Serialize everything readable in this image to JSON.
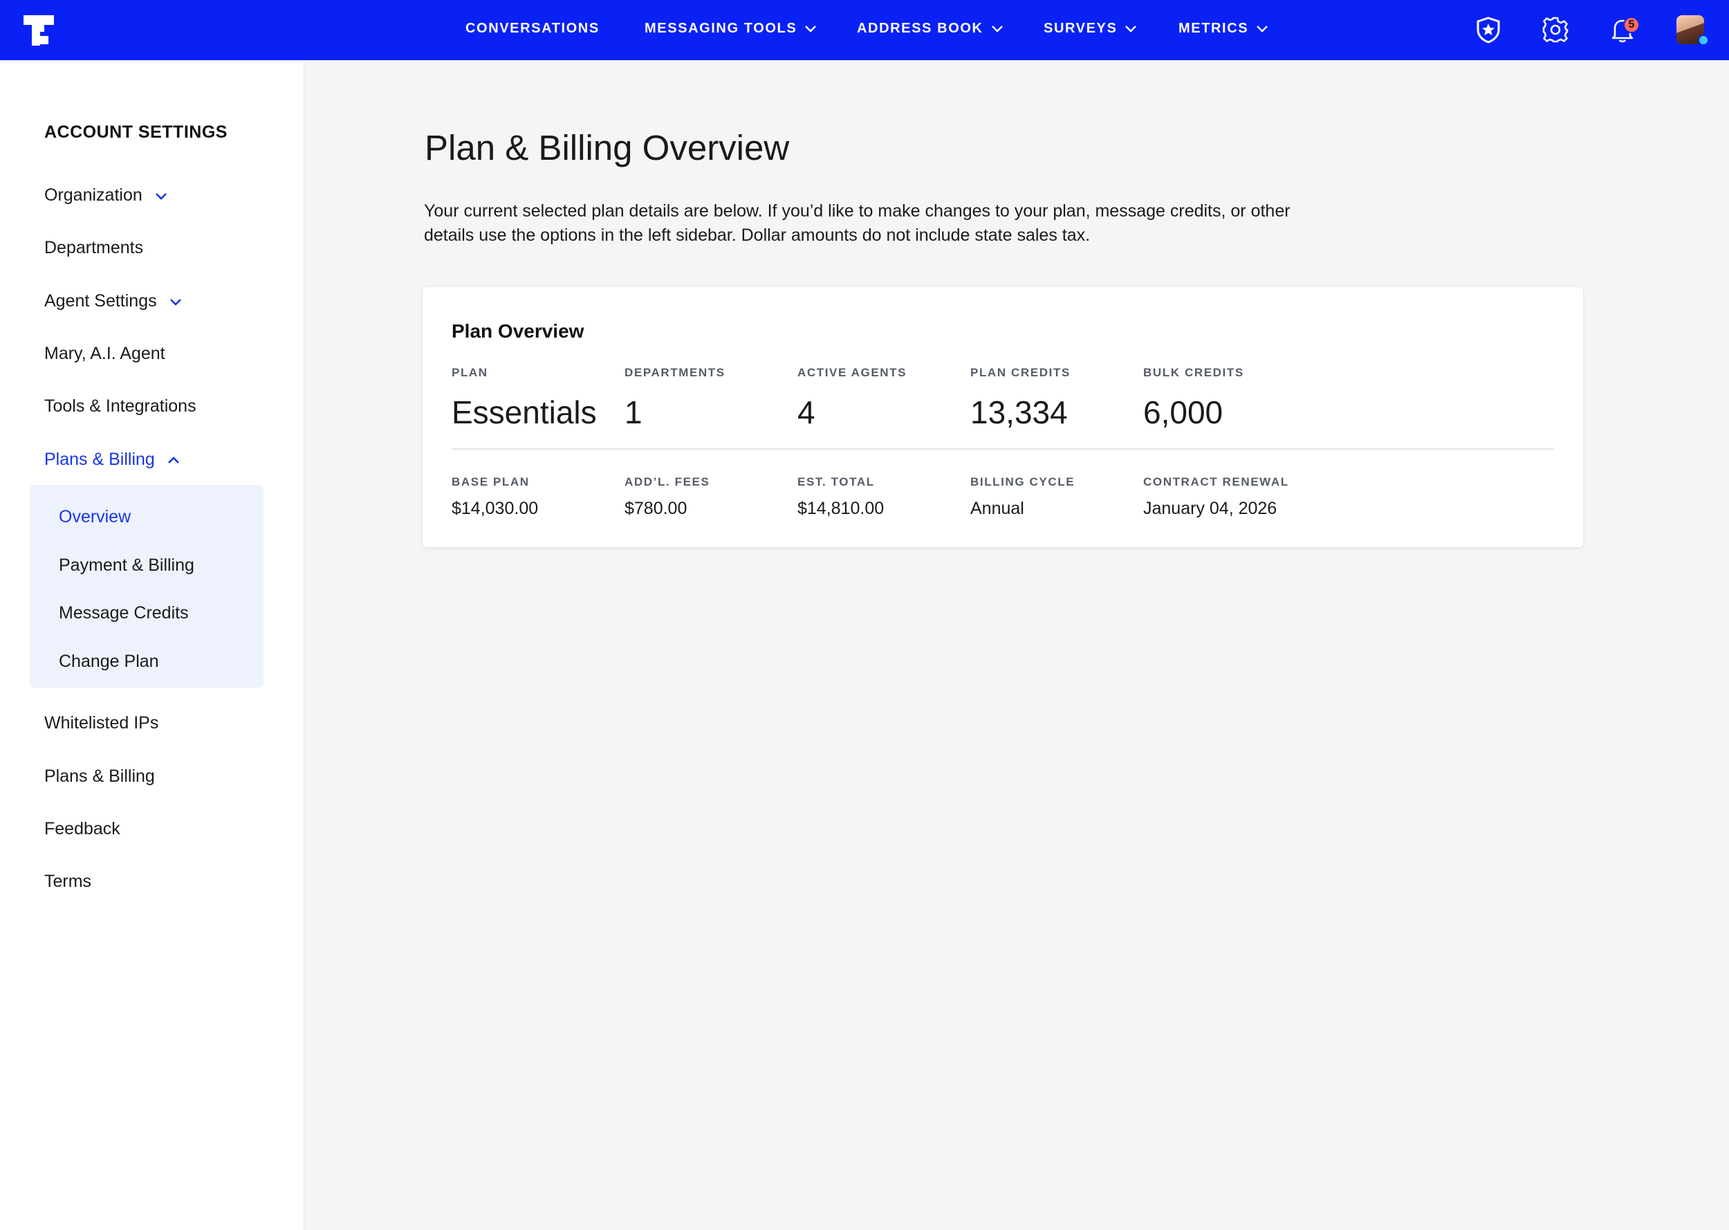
{
  "colors": {
    "brand_blue": "#0a21f5",
    "active_link": "#1a35e8",
    "submenu_bg": "#edf2fd",
    "notification_badge": "#ff6b5b",
    "online_status": "#3ec8ff"
  },
  "topbar": {
    "logo_icon": "text-logo-icon",
    "nav": [
      {
        "label": "CONVERSATIONS",
        "dropdown": false
      },
      {
        "label": "MESSAGING TOOLS",
        "dropdown": true
      },
      {
        "label": "ADDRESS BOOK",
        "dropdown": true
      },
      {
        "label": "SURVEYS",
        "dropdown": true
      },
      {
        "label": "METRICS",
        "dropdown": true
      }
    ],
    "icons": [
      "shield-star-icon",
      "gear-icon",
      "bell-icon",
      "avatar"
    ],
    "notification_count": "5"
  },
  "sidebar": {
    "heading": "ACCOUNT SETTINGS",
    "items": [
      {
        "label": "Organization",
        "chevron": "down"
      },
      {
        "label": "Departments"
      },
      {
        "label": "Agent Settings",
        "chevron": "down"
      },
      {
        "label": "Mary, A.I. Agent"
      },
      {
        "label": "Tools & Integrations"
      },
      {
        "label": "Plans & Billing",
        "chevron": "up",
        "active": true
      },
      {
        "label": "Whitelisted IPs"
      },
      {
        "label": "Plans & Billing"
      },
      {
        "label": "Feedback"
      },
      {
        "label": "Terms"
      }
    ],
    "submenu": [
      {
        "label": "Overview",
        "active": true
      },
      {
        "label": "Payment & Billing"
      },
      {
        "label": "Message Credits"
      },
      {
        "label": "Change Plan"
      }
    ]
  },
  "main": {
    "title": "Plan & Billing Overview",
    "description": "Your current selected plan details are below. If you’d like to make changes to your plan, message credits, or other details use the options in the left sidebar. Dollar amounts do not include state sales tax.",
    "card": {
      "title": "Plan Overview",
      "top_stats": [
        {
          "label": "PLAN",
          "value": "Essentials"
        },
        {
          "label": "DEPARTMENTS",
          "value": "1"
        },
        {
          "label": "ACTIVE AGENTS",
          "value": "4"
        },
        {
          "label": "PLAN CREDITS",
          "value": "13,334"
        },
        {
          "label": "BULK CREDITS",
          "value": "6,000"
        }
      ],
      "bottom_stats": [
        {
          "label": "BASE PLAN",
          "value": "$14,030.00"
        },
        {
          "label": "ADD’L. FEES",
          "value": "$780.00"
        },
        {
          "label": "EST. TOTAL",
          "value": "$14,810.00"
        },
        {
          "label": "BILLING CYCLE",
          "value": "Annual"
        },
        {
          "label": "CONTRACT RENEWAL",
          "value": "January 04, 2026"
        }
      ]
    }
  }
}
